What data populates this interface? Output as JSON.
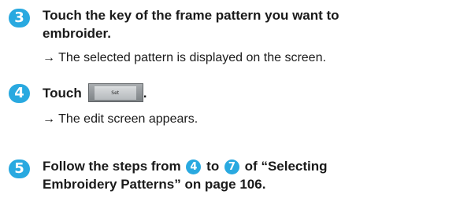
{
  "steps": [
    {
      "number": "3",
      "line1": "Touch the key of the frame pattern you want to",
      "line2": "embroider.",
      "result_arrow": "→",
      "result": "The selected pattern is displayed on the screen."
    },
    {
      "number": "4",
      "instruction": "Touch",
      "key_label": "Set",
      "key_end": ".",
      "result_arrow": "→",
      "result": "The edit screen appears."
    },
    {
      "number": "5",
      "line1_part1": "Follow the steps from",
      "ref_from": "4",
      "line1_part2": "to",
      "ref_to": "7",
      "line1_part3": "of “Selecting",
      "line2": "Embroidery Patterns” on page 106."
    }
  ],
  "colors": {
    "step_badge": "#29a9e0",
    "text": "#1a1a1a"
  }
}
